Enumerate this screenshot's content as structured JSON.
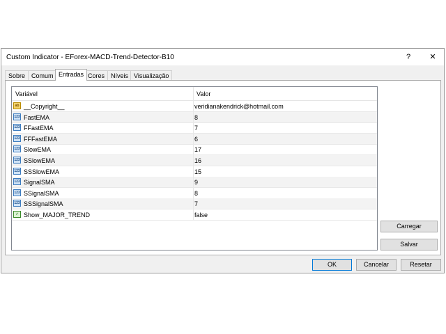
{
  "window": {
    "title": "Custom Indicator - EForex-MACD-Trend-Detector-B10",
    "help_glyph": "?",
    "close_glyph": "✕"
  },
  "tabs": [
    "Sobre",
    "Comum",
    "Entradas",
    "Cores",
    "Níveis",
    "Visualização"
  ],
  "active_tab": "Entradas",
  "grid": {
    "headers": {
      "name": "Variável",
      "value": "Valor"
    },
    "rows": [
      {
        "icon": "ab",
        "icon_name": "string-type-icon",
        "name": "__Copyright__",
        "value": "veridianakendrick@hotmail.com"
      },
      {
        "icon": "123",
        "icon_name": "integer-type-icon",
        "name": "FastEMA",
        "value": "8"
      },
      {
        "icon": "123",
        "icon_name": "integer-type-icon",
        "name": "FFastEMA",
        "value": "7"
      },
      {
        "icon": "123",
        "icon_name": "integer-type-icon",
        "name": "FFFastEMA",
        "value": "6"
      },
      {
        "icon": "123",
        "icon_name": "integer-type-icon",
        "name": "SlowEMA",
        "value": "17"
      },
      {
        "icon": "123",
        "icon_name": "integer-type-icon",
        "name": "SSlowEMA",
        "value": "16"
      },
      {
        "icon": "123",
        "icon_name": "integer-type-icon",
        "name": "SSSlowEMA",
        "value": "15"
      },
      {
        "icon": "123",
        "icon_name": "integer-type-icon",
        "name": "SignalSMA",
        "value": "9"
      },
      {
        "icon": "123",
        "icon_name": "integer-type-icon",
        "name": "SSignalSMA",
        "value": "8"
      },
      {
        "icon": "123",
        "icon_name": "integer-type-icon",
        "name": "SSSignalSMA",
        "value": "7"
      },
      {
        "icon": "✓",
        "icon_name": "boolean-type-icon",
        "name": "Show_MAJOR_TREND",
        "value": "false"
      }
    ]
  },
  "side_buttons": {
    "load": "Carregar",
    "save": "Salvar"
  },
  "footer_buttons": {
    "ok": "OK",
    "cancel": "Cancelar",
    "reset": "Resetar"
  },
  "colors": {
    "accent": "#0078d7",
    "dialog_bg": "#f0f0f0",
    "row_alt": "#f3f3f3"
  }
}
